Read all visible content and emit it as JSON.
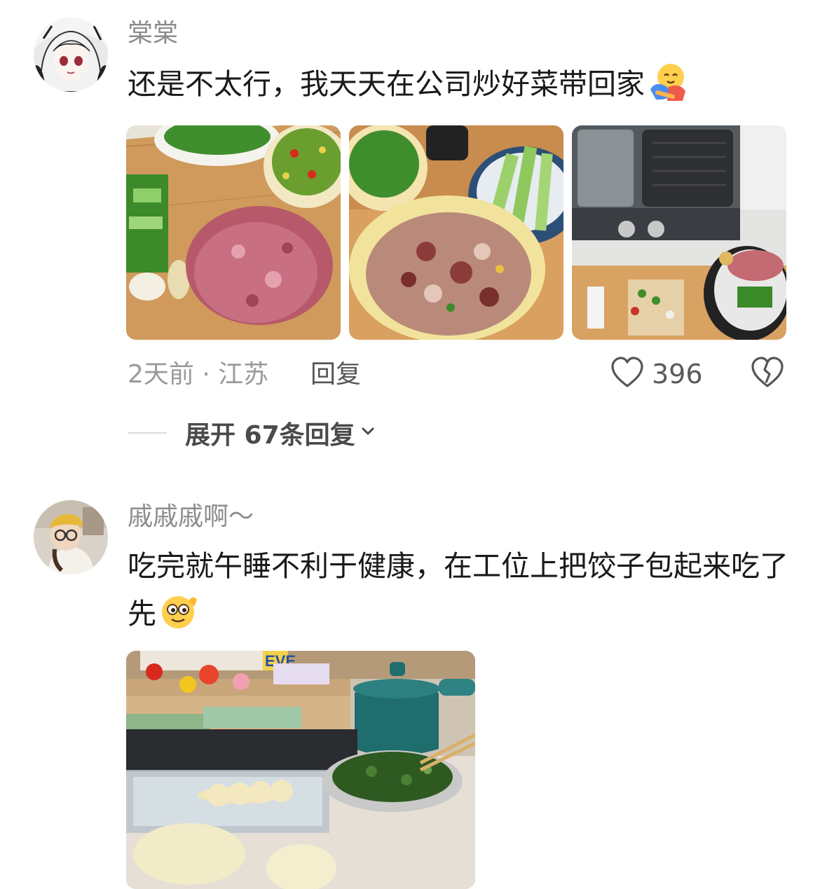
{
  "comments": [
    {
      "username": "棠棠",
      "text": "还是不太行，我天天在公司炒好菜带回家",
      "emoji": "hugging-face",
      "time_location": "2天前 · 江苏",
      "reply_label": "回复",
      "like_count": "396",
      "expand_label": "展开 67条回复"
    },
    {
      "username": "戚戚戚啊～",
      "text": "吃完就午睡不利于健康，在工位上把饺子包起来吃了先",
      "emoji": "cheeky-face",
      "photo_label": "EVE"
    }
  ],
  "colors": {
    "username": "#8c8c8c",
    "text": "#1a1a1a",
    "meta": "#9a9a9a",
    "icon": "#555555"
  }
}
